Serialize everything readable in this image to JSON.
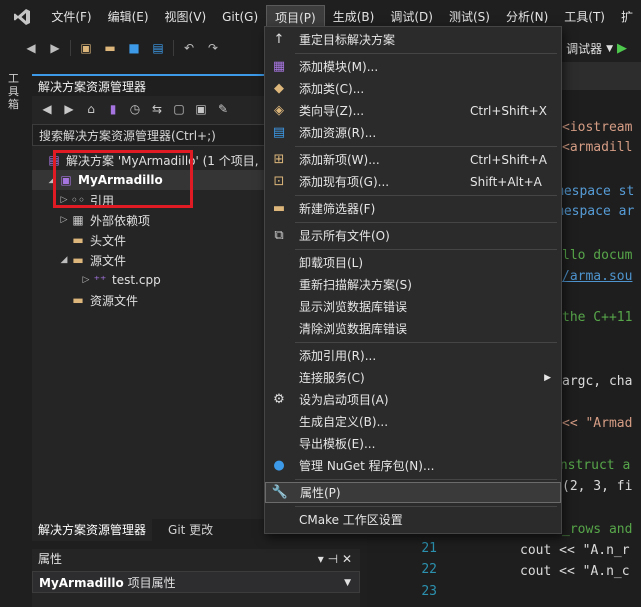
{
  "menubar": {
    "items": [
      "文件(F)",
      "编辑(E)",
      "视图(V)",
      "Git(G)",
      "项目(P)",
      "生成(B)",
      "调试(D)",
      "测试(S)",
      "分析(N)",
      "工具(T)",
      "扩"
    ]
  },
  "toolbar": {
    "debugger_label": "调试器"
  },
  "vstrip": {
    "label": "工具箱"
  },
  "explorer": {
    "title": "解决方案资源管理器",
    "search_placeholder": "搜索解决方案资源管理器(Ctrl+;)",
    "tree": {
      "solution": "解决方案 'MyArmadillo' (1 个项目,",
      "project": "MyArmadillo",
      "refs": "引用",
      "ext_deps": "外部依赖项",
      "headers": "头文件",
      "sources": "源文件",
      "test_cpp": "test.cpp",
      "resources": "资源文件"
    }
  },
  "bottom_tabs": [
    "解决方案资源管理器",
    "Git 更改"
  ],
  "properties": {
    "title": "属性",
    "selected": "MyArmadillo",
    "selected_suffix": "项目属性"
  },
  "editor": {
    "lines": {
      "l1": "<iostream",
      "l2": "<armadill",
      "l3": "mespace st",
      "l4": "mespace ar",
      "l5": "llo docum",
      "l6": "/arma.sou",
      "l7": "the C++11",
      "l8": "argc, cha",
      "l9": "<< \"Armad",
      "l10": "onstruct a",
      "l11": "(2, 3, fi",
      "l12": "_rows and",
      "l13": "cout << \"A.n_r",
      "l14": "cout << \"A.n_c"
    },
    "line_numbers": [
      "21",
      "22",
      "23"
    ]
  },
  "dropdown": {
    "items": {
      "rescope": "重定目标解决方案",
      "add_module": "添加模块(M)...",
      "add_class": "添加类(C)...",
      "class_wizard": "类向导(Z)...",
      "class_wizard_sc": "Ctrl+Shift+X",
      "add_resource": "添加资源(R)...",
      "add_new": "添加新项(W)...",
      "add_new_sc": "Ctrl+Shift+A",
      "add_existing": "添加现有项(G)...",
      "add_existing_sc": "Shift+Alt+A",
      "new_filter": "新建筛选器(F)",
      "show_all": "显示所有文件(O)",
      "unload": "卸载项目(L)",
      "rescan": "重新扫描解决方案(S)",
      "show_browse_err": "显示浏览数据库错误",
      "clear_browse_err": "清除浏览数据库错误",
      "add_ref": "添加引用(R)...",
      "connected": "连接服务(C)",
      "set_startup": "设为启动项目(A)",
      "build_custom": "生成自定义(B)...",
      "export_template": "导出模板(E)...",
      "nuget": "管理 NuGet 程序包(N)...",
      "properties": "属性(P)",
      "cmake": "CMake 工作区设置"
    }
  }
}
